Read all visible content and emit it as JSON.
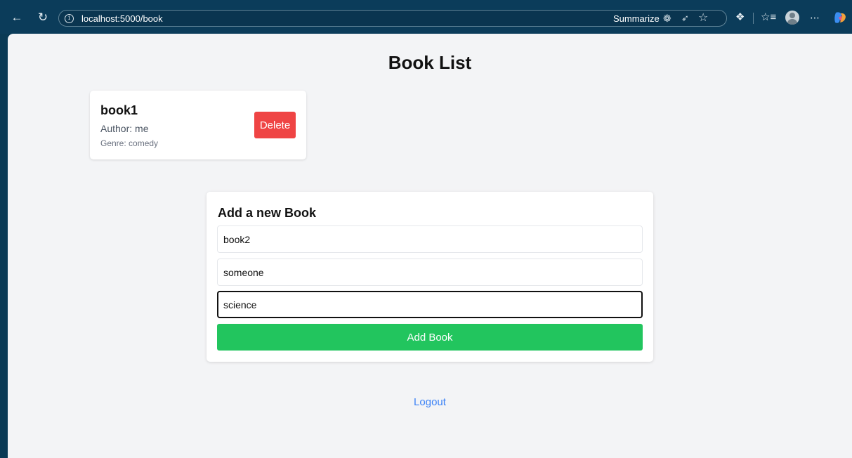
{
  "browser": {
    "url": "localhost:5000/book",
    "summarize_label": "Summarize",
    "accent_color": "#0b3c5a"
  },
  "page": {
    "title": "Book List",
    "books": [
      {
        "title": "book1",
        "author": "Author: me",
        "genre": "Genre: comedy",
        "delete_label": "Delete"
      }
    ],
    "form": {
      "heading": "Add a new Book",
      "title_value": "book2",
      "author_value": "someone",
      "genre_value": "science",
      "submit_label": "Add Book"
    },
    "logout_label": "Logout",
    "colors": {
      "delete": "#ef4444",
      "add": "#22c55e",
      "link": "#3b82f6"
    }
  }
}
